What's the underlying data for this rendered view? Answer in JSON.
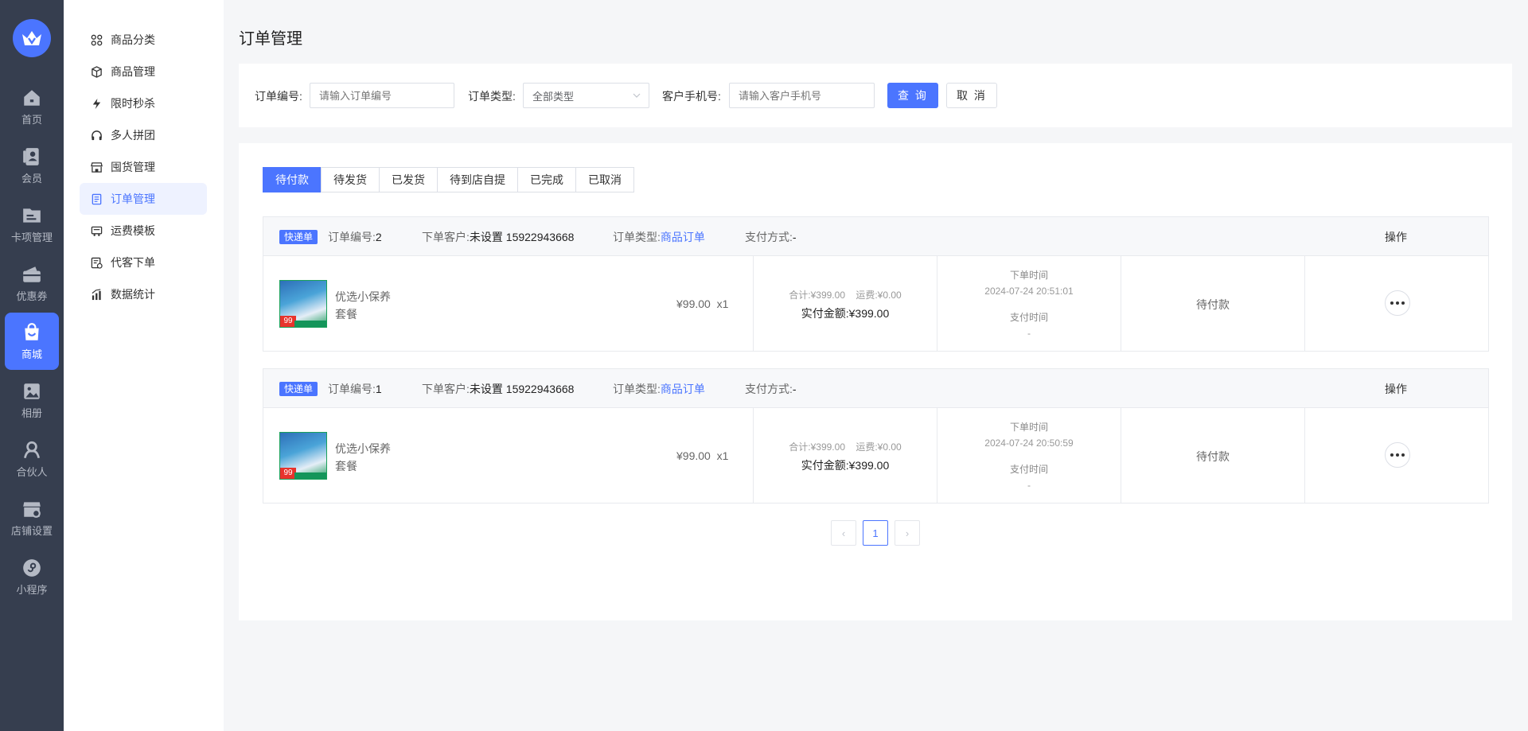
{
  "rail": {
    "items": [
      {
        "label": "首页",
        "icon": "home-icon"
      },
      {
        "label": "会员",
        "icon": "member-icon"
      },
      {
        "label": "卡项管理",
        "icon": "card-icon"
      },
      {
        "label": "优惠券",
        "icon": "coupon-icon"
      },
      {
        "label": "商城",
        "icon": "shop-bag-icon",
        "active": true
      },
      {
        "label": "相册",
        "icon": "album-icon"
      },
      {
        "label": "合伙人",
        "icon": "partner-icon"
      },
      {
        "label": "店铺设置",
        "icon": "store-settings-icon"
      },
      {
        "label": "小程序",
        "icon": "mini-program-icon"
      }
    ]
  },
  "submenu": {
    "items": [
      {
        "label": "商品分类",
        "icon": "category-grid-icon"
      },
      {
        "label": "商品管理",
        "icon": "box-icon"
      },
      {
        "label": "限时秒杀",
        "icon": "lightning-icon"
      },
      {
        "label": "多人拼团",
        "icon": "headset-icon"
      },
      {
        "label": "囤货管理",
        "icon": "store-icon"
      },
      {
        "label": "订单管理",
        "icon": "order-doc-icon",
        "active": true
      },
      {
        "label": "运费模板",
        "icon": "truck-icon"
      },
      {
        "label": "代客下单",
        "icon": "proxy-order-icon"
      },
      {
        "label": "数据统计",
        "icon": "bar-chart-icon"
      }
    ]
  },
  "page": {
    "title": "订单管理"
  },
  "filters": {
    "order_no_label": "订单编号:",
    "order_no_placeholder": "请输入订单编号",
    "order_type_label": "订单类型:",
    "order_type_value": "全部类型",
    "phone_label": "客户手机号:",
    "phone_placeholder": "请输入客户手机号",
    "query_button": "查 询",
    "cancel_button": "取 消"
  },
  "tabs": [
    "待付款",
    "待发货",
    "已发货",
    "待到店自提",
    "已完成",
    "已取消"
  ],
  "active_tab": "待付款",
  "orders": [
    {
      "badge": "快递单",
      "order_no_label": "订单编号:",
      "order_no": "2",
      "customer_label": "下单客户:",
      "customer": "未设置 15922943668",
      "type_label": "订单类型:",
      "type": "商品订单",
      "pay_label": "支付方式:",
      "pay": "-",
      "op_label": "操作",
      "product_name": "优选小保养套餐",
      "thumb_tag": "99",
      "price": "¥99.00",
      "qty": "x1",
      "total_line": "合计:¥399.00",
      "shipping_line": "运费:¥0.00",
      "actual_line": "实付金额:¥399.00",
      "order_time_label": "下单时间",
      "order_time": "2024-07-24 20:51:01",
      "pay_time_label": "支付时间",
      "pay_time": "-",
      "status": "待付款"
    },
    {
      "badge": "快递单",
      "order_no_label": "订单编号:",
      "order_no": "1",
      "customer_label": "下单客户:",
      "customer": "未设置 15922943668",
      "type_label": "订单类型:",
      "type": "商品订单",
      "pay_label": "支付方式:",
      "pay": "-",
      "op_label": "操作",
      "product_name": "优选小保养套餐",
      "thumb_tag": "99",
      "price": "¥99.00",
      "qty": "x1",
      "total_line": "合计:¥399.00",
      "shipping_line": "运费:¥0.00",
      "actual_line": "实付金额:¥399.00",
      "order_time_label": "下单时间",
      "order_time": "2024-07-24 20:50:59",
      "pay_time_label": "支付时间",
      "pay_time": "-",
      "status": "待付款"
    }
  ],
  "pagination": {
    "prev": "‹",
    "current": "1",
    "next": "›"
  },
  "colors": {
    "accent": "#4b75ff",
    "rail_bg": "#363e4f"
  }
}
